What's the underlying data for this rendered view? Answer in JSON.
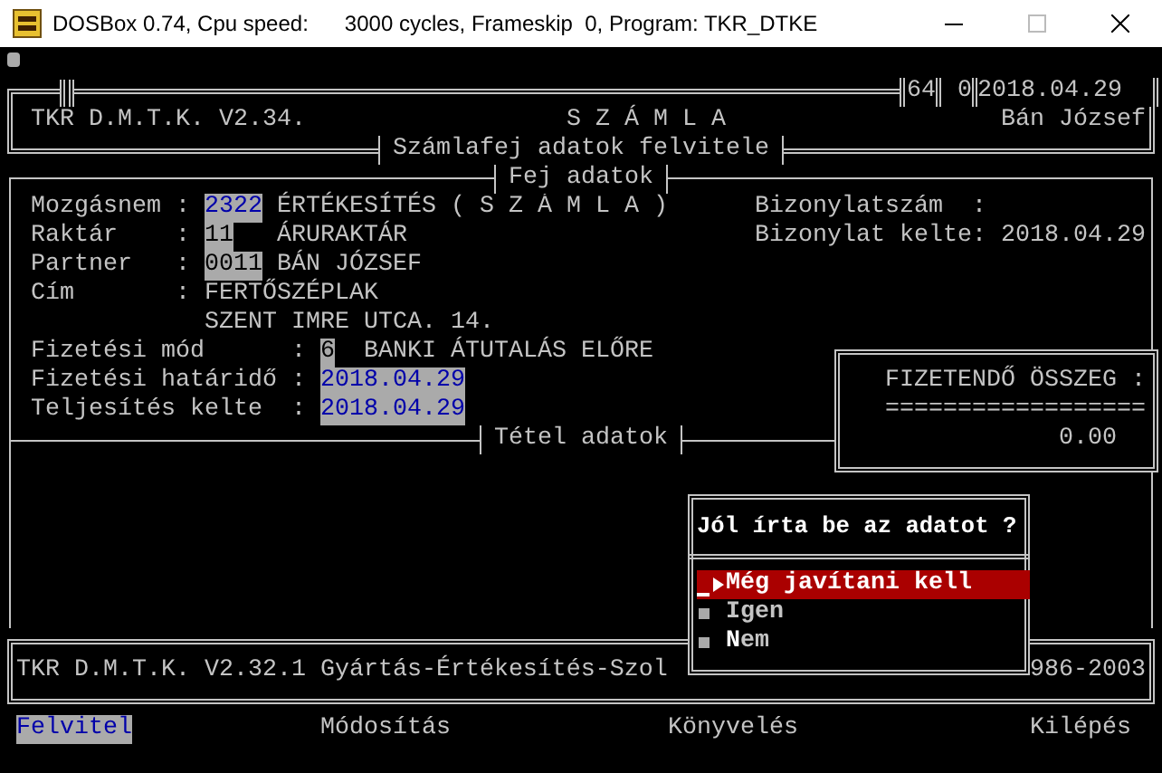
{
  "window": {
    "title": "DOSBox 0.74, Cpu speed:      3000 cycles, Frameskip  0, Program: TKR_DTKE"
  },
  "header": {
    "app": "TKR D.M.T.K. V2.34.",
    "document": "S Z Á M L A",
    "user": "Bán József",
    "counters": [
      "64",
      "0"
    ],
    "date": "2018.04.29",
    "section": "Számlafej adatok felvitele"
  },
  "head_panel": {
    "title": "Fej adatok",
    "fields": [
      {
        "label": "Mozgásnem",
        "separator": ":",
        "code": "2322",
        "selected": true,
        "text": "ÉRTÉKESÍTÉS ( S Z Á M L A )"
      },
      {
        "label": "Raktár",
        "separator": ":",
        "code": "11",
        "selected": false,
        "text": "ÁRURAKTÁR"
      },
      {
        "label": "Partner",
        "separator": ":",
        "code": "0011",
        "selected": false,
        "text": "BÁN JÓZSEF"
      },
      {
        "label": "Cím",
        "separator": ":",
        "text": "FERTŐSZÉPLAK"
      },
      {
        "text": "SZENT IMRE UTCA. 14."
      },
      {
        "label": "Fizetési mód",
        "separator": ":",
        "code": "6",
        "selected": false,
        "text": "BANKI ÁTUTALÁS ELŐRE"
      },
      {
        "label": "Fizetési határidő",
        "separator": ":",
        "code": "2018.04.29",
        "selected": true
      },
      {
        "label": "Teljesítés kelte",
        "separator": ":",
        "code": "2018.04.29",
        "selected": true
      }
    ],
    "document_fields": [
      {
        "label": "Bizonylatszám",
        "separator": ":"
      },
      {
        "label": "Bizonylat kelte",
        "separator": ":",
        "value": "2018.04.29"
      }
    ]
  },
  "total": {
    "label": "FIZETENDŐ ÖSSZEG :",
    "rule": "==================",
    "amount": "0.00"
  },
  "items_panel": {
    "title": "Tétel adatok"
  },
  "footer": {
    "text": "TKR D.M.T.K. V2.32.1 Gyártás-Értékesítés-Szol",
    "years": "986-2003"
  },
  "dialog": {
    "question": "Jól írta be az adatot ?",
    "options": [
      {
        "label": "Még javítani kell",
        "selected": true
      },
      {
        "label": "Igen",
        "selected": false
      },
      {
        "label": "**N**em",
        "selected": false
      }
    ]
  },
  "menu": [
    {
      "label": "Felvitel",
      "selected": true
    },
    {
      "label": "Módosítás",
      "selected": false
    },
    {
      "label": "Könyvelés",
      "selected": false
    },
    {
      "label": "Kilépés",
      "selected": false
    }
  ]
}
